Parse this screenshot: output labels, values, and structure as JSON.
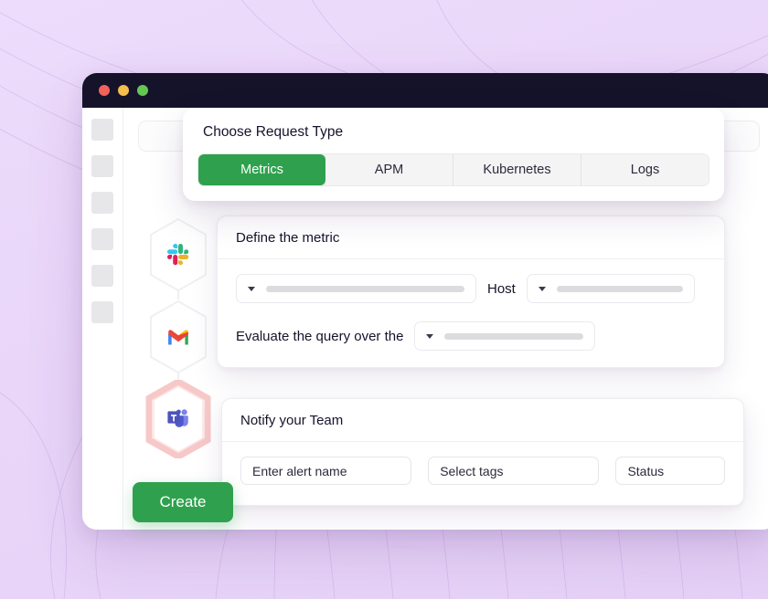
{
  "window": {
    "traffic_lights": [
      {
        "name": "close",
        "color": "#F1625B"
      },
      {
        "name": "minimize",
        "color": "#F3BE4E"
      },
      {
        "name": "maximize",
        "color": "#64C753"
      }
    ],
    "titlebar_color": "#15132A",
    "rail_block_count": 6
  },
  "theme": {
    "background": "#EBD9FA",
    "accent_green": "#2FA14E",
    "text_dark": "#15132A",
    "skeleton_gray": "#DCDCDF",
    "teams_glow": "#F2A7A7"
  },
  "modal": {
    "title": "Choose Request Type",
    "tabs": [
      {
        "label": "Metrics",
        "active": true
      },
      {
        "label": "APM",
        "active": false
      },
      {
        "label": "Kubernetes",
        "active": false
      },
      {
        "label": "Logs",
        "active": false
      }
    ]
  },
  "define_metric": {
    "header": "Define the metric",
    "host_label": "Host",
    "evaluate_label": "Evaluate the query over the",
    "metric_select_value": "",
    "host_select_value": "",
    "window_select_value": ""
  },
  "notify_team": {
    "header": "Notify your Team",
    "fields": [
      {
        "name": "alert-name",
        "placeholder": "Enter alert name"
      },
      {
        "name": "tags",
        "placeholder": "Select tags"
      },
      {
        "name": "status",
        "placeholder": "Status"
      }
    ]
  },
  "integrations": [
    {
      "name": "slack",
      "label": "Slack",
      "highlighted": false
    },
    {
      "name": "gmail",
      "label": "Gmail",
      "highlighted": false
    },
    {
      "name": "teams",
      "label": "Microsoft Teams",
      "highlighted": true
    }
  ],
  "actions": {
    "create_label": "Create"
  }
}
